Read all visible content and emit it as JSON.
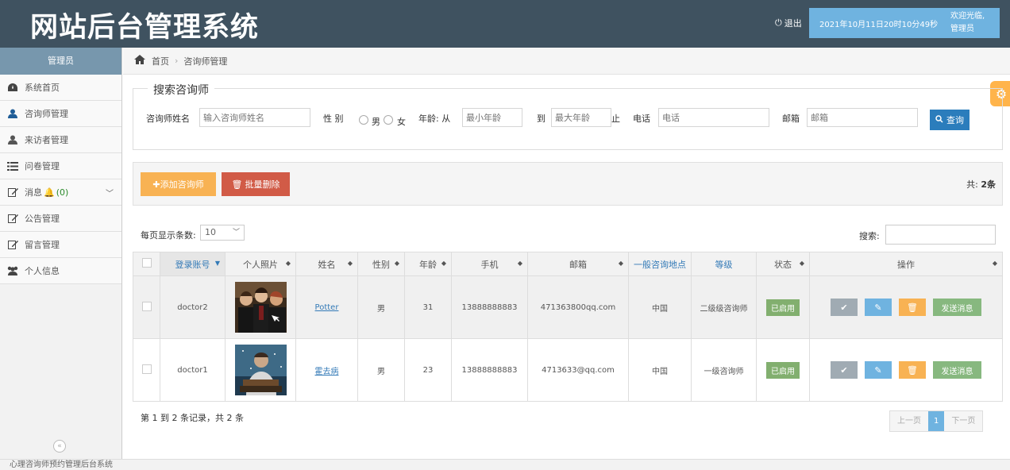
{
  "header": {
    "title": "网站后台管理系统",
    "logout": "退出",
    "datetime": "2021年10月11日20时10分49秒",
    "welcome_line1": "欢迎光临,",
    "welcome_line2": "管理员"
  },
  "sidebar": {
    "title": "管理员",
    "items": [
      {
        "label": "系统首页",
        "icon": "dashboard-icon"
      },
      {
        "label": "咨询师管理",
        "icon": "user-icon"
      },
      {
        "label": "来访者管理",
        "icon": "user-icon"
      },
      {
        "label": "问卷管理",
        "icon": "list-icon"
      },
      {
        "label": "消息",
        "icon": "edit-icon",
        "badge": "(0)"
      },
      {
        "label": "公告管理",
        "icon": "edit-icon"
      },
      {
        "label": "留言管理",
        "icon": "edit-icon"
      },
      {
        "label": "个人信息",
        "icon": "users-icon"
      }
    ]
  },
  "breadcrumb": {
    "home": "首页",
    "current": "咨询师管理"
  },
  "search": {
    "legend": "搜索咨询师",
    "name_label": "咨询师姓名",
    "name_placeholder": "输入咨询师姓名",
    "gender_label": "性 别",
    "male": "男",
    "female": "女",
    "age_label": "年龄: 从",
    "age_min_placeholder": "最小年龄",
    "to": "到",
    "age_max_placeholder": "最大年龄",
    "end": "止",
    "phone_label": "电话",
    "phone_placeholder": "电话",
    "email_label": "邮箱",
    "email_placeholder": "邮箱",
    "query_button": "查询"
  },
  "toolbar": {
    "add_label": "添加咨询师",
    "batch_delete_label": "批量删除",
    "total_prefix": "共: ",
    "total_count": "2条"
  },
  "table_controls": {
    "page_size_label": "每页显示条数:",
    "page_size": "10",
    "search_label": "搜索:"
  },
  "table": {
    "columns": [
      "登录账号",
      "个人照片",
      "姓名",
      "性别",
      "年龄",
      "手机",
      "邮箱",
      "一般咨询地点",
      "等级",
      "状态",
      "操作"
    ],
    "rows": [
      {
        "account": "doctor2",
        "name": "Potter",
        "gender": "男",
        "age": "31",
        "phone": "13888888883",
        "email": "471363800qq.com",
        "location": "中国",
        "level": "二级级咨询师",
        "status": "已启用",
        "send": "发送消息"
      },
      {
        "account": "doctor1",
        "name": "霍去病",
        "gender": "男",
        "age": "23",
        "phone": "13888888883",
        "email": "4713633@qq.com",
        "location": "中国",
        "level": "一级咨询师",
        "status": "已启用",
        "send": "发送消息"
      }
    ]
  },
  "pagination": {
    "info": "第 1 到 2 条记录，共 2 条",
    "prev": "上一页",
    "current": "1",
    "next": "下一页"
  },
  "footer": {
    "text": "心理咨询师预约管理后台系统"
  },
  "colors": {
    "header_bg": "#3f5260",
    "accent_blue": "#6fb3e0",
    "orange": "#f8b253",
    "red": "#d15b47",
    "green": "#87b87f"
  }
}
